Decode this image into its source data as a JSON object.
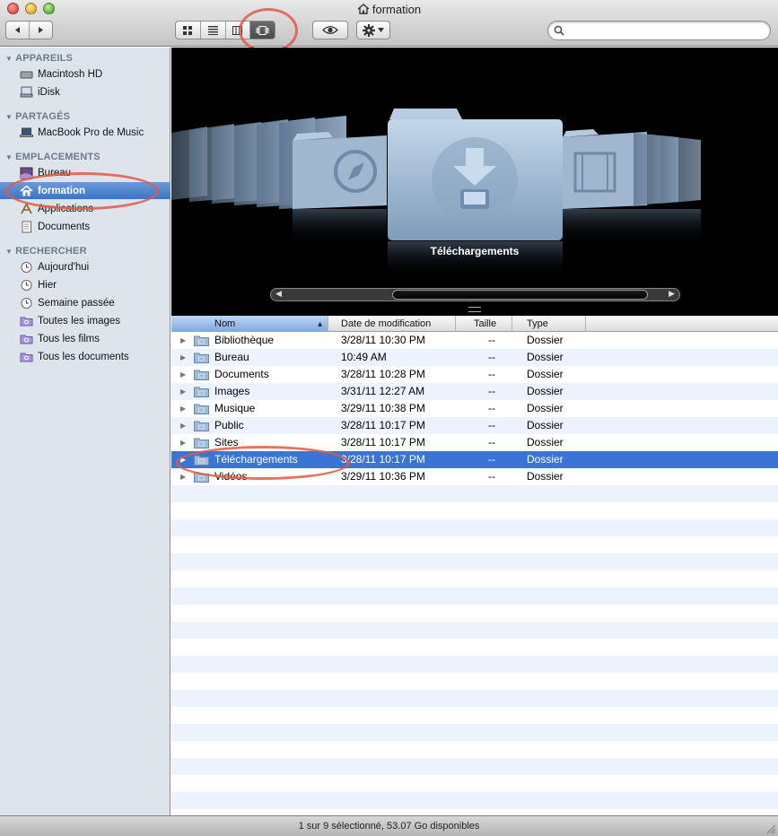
{
  "window": {
    "title": "formation"
  },
  "toolbar": {
    "back_icon": "back-arrow-icon",
    "forward_icon": "forward-arrow-icon",
    "views": [
      "icon-view-icon",
      "list-view-icon",
      "column-view-icon",
      "coverflow-view-icon"
    ],
    "active_view": "coverflow",
    "search": {
      "value": "",
      "placeholder": ""
    }
  },
  "sidebar": {
    "sections": [
      {
        "title": "APPAREILS",
        "items": [
          {
            "label": "Macintosh HD",
            "icon": "hard-drive-icon"
          },
          {
            "label": "iDisk",
            "icon": "idisk-icon"
          }
        ]
      },
      {
        "title": "PARTAGÉS",
        "items": [
          {
            "label": "MacBook Pro de Music",
            "icon": "laptop-icon"
          }
        ]
      },
      {
        "title": "EMPLACEMENTS",
        "items": [
          {
            "label": "Bureau",
            "icon": "desktop-icon"
          },
          {
            "label": "formation",
            "icon": "home-icon",
            "selected": true
          },
          {
            "label": "Applications",
            "icon": "applications-icon"
          },
          {
            "label": "Documents",
            "icon": "documents-icon"
          }
        ]
      },
      {
        "title": "RECHERCHER",
        "items": [
          {
            "label": "Aujourd'hui",
            "icon": "clock-icon"
          },
          {
            "label": "Hier",
            "icon": "clock-icon"
          },
          {
            "label": "Semaine passée",
            "icon": "clock-icon"
          },
          {
            "label": "Toutes les images",
            "icon": "smart-folder-icon"
          },
          {
            "label": "Tous les films",
            "icon": "smart-folder-icon"
          },
          {
            "label": "Tous les documents",
            "icon": "smart-folder-icon"
          }
        ]
      }
    ]
  },
  "coverflow": {
    "caption": "Téléchargements"
  },
  "list": {
    "columns": {
      "name": "Nom",
      "date": "Date de modification",
      "size": "Taille",
      "type": "Type"
    },
    "rows": [
      {
        "name": "Bibliothèque",
        "date": "3/28/11 10:30 PM",
        "size": "--",
        "type": "Dossier"
      },
      {
        "name": "Bureau",
        "date": "10:49 AM",
        "size": "--",
        "type": "Dossier"
      },
      {
        "name": "Documents",
        "date": "3/28/11 10:28 PM",
        "size": "--",
        "type": "Dossier"
      },
      {
        "name": "Images",
        "date": "3/31/11 12:27 AM",
        "size": "--",
        "type": "Dossier"
      },
      {
        "name": "Musique",
        "date": "3/29/11 10:38 PM",
        "size": "--",
        "type": "Dossier"
      },
      {
        "name": "Public",
        "date": "3/28/11 10:17 PM",
        "size": "--",
        "type": "Dossier"
      },
      {
        "name": "Sites",
        "date": "3/28/11 10:17 PM",
        "size": "--",
        "type": "Dossier"
      },
      {
        "name": "Téléchargements",
        "date": "3/28/11 10:17 PM",
        "size": "--",
        "type": "Dossier",
        "selected": true
      },
      {
        "name": "Vidéos",
        "date": "3/29/11 10:36 PM",
        "size": "--",
        "type": "Dossier"
      }
    ]
  },
  "status": {
    "text": "1 sur 9 sélectionné, 53.07 Go disponibles"
  },
  "colors": {
    "selection": "#3a74d4",
    "sidebar_bg": "#dde4ec",
    "row_alt": "#edf3fe",
    "annotation": "#e25a46"
  }
}
